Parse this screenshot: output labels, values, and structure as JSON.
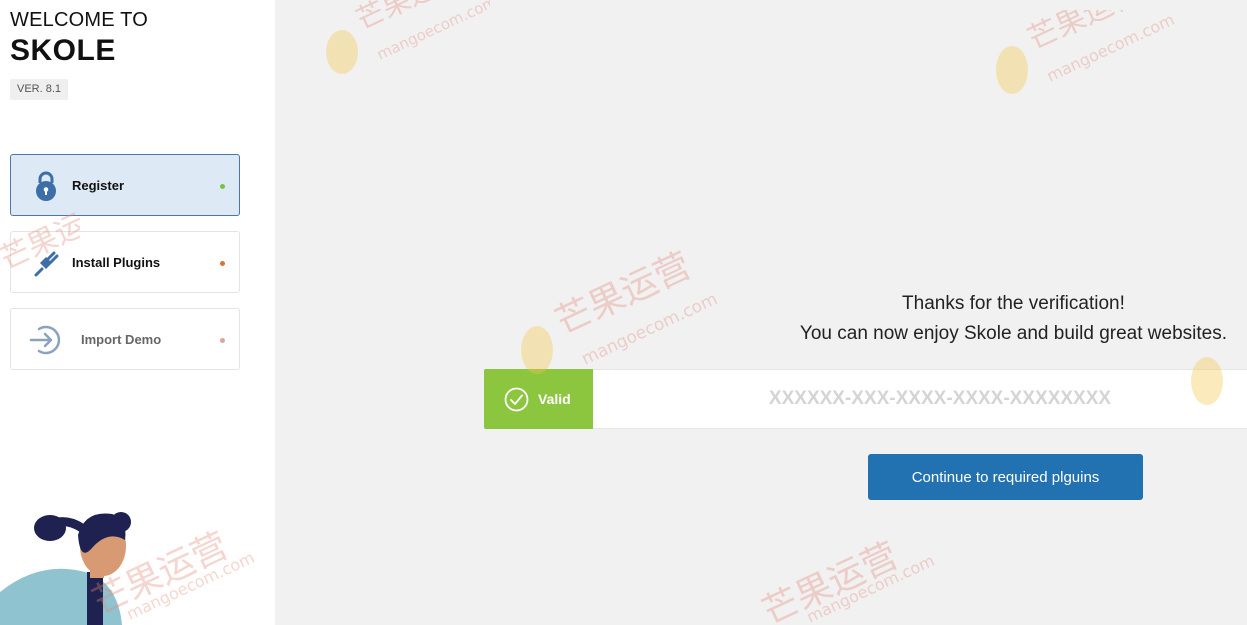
{
  "sidebar": {
    "welcome": "WELCOME TO",
    "brand": "SKOLE",
    "version": "VER. 8.1",
    "steps": [
      {
        "label": "Register",
        "icon": "lock-icon",
        "status_color": "#7cc242",
        "active": true
      },
      {
        "label": "Install Plugins",
        "icon": "plug-icon",
        "status_color": "#d4763b",
        "active": false
      },
      {
        "label": "Import Demo",
        "icon": "arrow-right-circle-icon",
        "status_color": "#d9a899",
        "active": false
      }
    ]
  },
  "main": {
    "thanks_line1": "Thanks for the verification!",
    "thanks_line2": "You can now enjoy Skole and build great websites.",
    "valid_label": "Valid",
    "license_placeholder": "XXXXXX-XXX-XXXX-XXXX-XXXXXXXX",
    "continue_label": "Continue to required plguins"
  },
  "watermark": {
    "text_cn": "芒果运营",
    "text_en": "mangoecom.com"
  },
  "colors": {
    "accent": "#2271b1",
    "valid": "#8cc63f",
    "active_step_bg": "#ddeaf5",
    "active_step_border": "#4d76a8"
  }
}
